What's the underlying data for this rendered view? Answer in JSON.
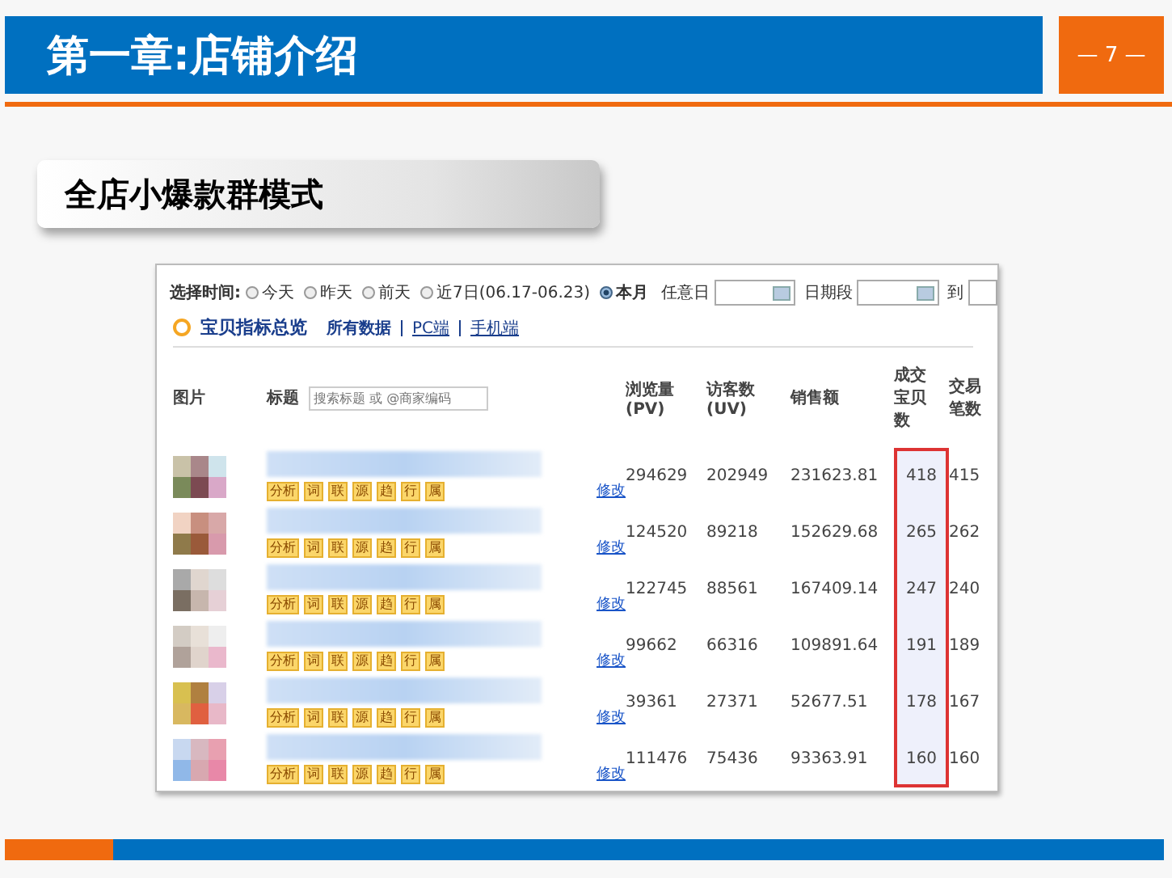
{
  "header": {
    "title": "第一章:店铺介绍",
    "page_number": "— 7 —"
  },
  "subtitle": "全店小爆款群模式",
  "panel": {
    "time_label": "选择时间:",
    "time_options": [
      {
        "label": "今天",
        "selected": false
      },
      {
        "label": "昨天",
        "selected": false
      },
      {
        "label": "前天",
        "selected": false
      },
      {
        "label": "近7日(06.17-06.23)",
        "selected": false
      },
      {
        "label": "本月",
        "selected": true
      }
    ],
    "date_fields": [
      {
        "label": "任意日"
      },
      {
        "label": "日期段"
      },
      {
        "label": "到"
      }
    ],
    "section_title": "宝贝指标总览",
    "links": [
      {
        "label": "所有数据",
        "selected": true
      },
      {
        "label": "PC端",
        "selected": false
      },
      {
        "label": "手机端",
        "selected": false
      }
    ],
    "search": {
      "placeholder": "搜索标题 或 @商家编码"
    },
    "columns": [
      {
        "label": "图片"
      },
      {
        "label": "标题"
      },
      {
        "label": "浏览量(PV)"
      },
      {
        "label": "访客数(UV)"
      },
      {
        "label": "销售额"
      },
      {
        "label": "成交宝贝数",
        "highlighted": true
      },
      {
        "label": "交易笔数"
      }
    ],
    "rows": [
      {
        "tags": [
          "分析",
          "词",
          "联",
          "源",
          "趋",
          "行",
          "属"
        ],
        "edit_link": "修改",
        "pv": "294629",
        "uv": "202949",
        "sales": "231623.81",
        "items": "418",
        "trades": "415"
      },
      {
        "tags": [
          "分析",
          "词",
          "联",
          "源",
          "趋",
          "行",
          "属"
        ],
        "edit_link": "修改",
        "pv": "124520",
        "uv": "89218",
        "sales": "152629.68",
        "items": "265",
        "trades": "262"
      },
      {
        "tags": [
          "分析",
          "词",
          "联",
          "源",
          "趋",
          "行",
          "属"
        ],
        "edit_link": "修改",
        "pv": "122745",
        "uv": "88561",
        "sales": "167409.14",
        "items": "247",
        "trades": "240"
      },
      {
        "tags": [
          "分析",
          "词",
          "联",
          "源",
          "趋",
          "行",
          "属"
        ],
        "edit_link": "修改",
        "pv": "99662",
        "uv": "66316",
        "sales": "109891.64",
        "items": "191",
        "trades": "189"
      },
      {
        "tags": [
          "分析",
          "词",
          "联",
          "源",
          "趋",
          "行",
          "属"
        ],
        "edit_link": "修改",
        "pv": "39361",
        "uv": "27371",
        "sales": "52677.51",
        "items": "178",
        "trades": "167"
      },
      {
        "tags": [
          "分析",
          "词",
          "联",
          "源",
          "趋",
          "行",
          "属"
        ],
        "edit_link": "修改",
        "pv": "111476",
        "uv": "75436",
        "sales": "93363.91",
        "items": "160",
        "trades": "160"
      }
    ]
  }
}
